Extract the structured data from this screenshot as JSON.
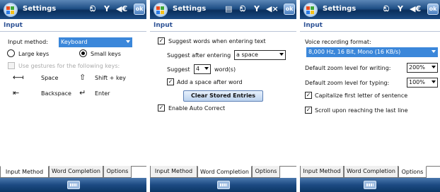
{
  "screens": [
    {
      "title": "Settings",
      "tray": {
        "signal": "ඞ",
        "antenna": "Υ",
        "volume": "◀€",
        "ok": "ok"
      },
      "section": "Input",
      "input_method_label": "Input method:",
      "input_method_value": "Keyboard",
      "large_keys_label": "Large keys",
      "small_keys_label": "Small keys",
      "selected_key_size": "small",
      "gestures_label": "Use gestures for the following keys:",
      "gestures": [
        {
          "icon": "space-gesture-icon",
          "glyph": "⟻",
          "label": "Space"
        },
        {
          "icon": "shift-gesture-icon",
          "glyph": "⇧",
          "label": "Shift + key"
        },
        {
          "icon": "backspace-gesture-icon",
          "glyph": "⇤",
          "label": "Backspace"
        },
        {
          "icon": "enter-gesture-icon",
          "glyph": "↵",
          "label": "Enter"
        }
      ],
      "tabs": [
        "Input Method",
        "Word Completion",
        "Options"
      ],
      "active_tab": 0
    },
    {
      "title": "Settings",
      "tray": {
        "extra": "▤",
        "signal": "ඞ",
        "antenna": "Υ",
        "volume": "◀×",
        "ok": "ok"
      },
      "section": "Input",
      "suggest_words_label": "Suggest words when entering text",
      "suggest_words_checked": true,
      "suggest_after_label": "Suggest after entering",
      "suggest_after_value": "a space",
      "suggest_count_label": "Suggest",
      "suggest_count_value": "4",
      "suggest_count_unit": "word(s)",
      "add_space_label": "Add a space after word",
      "add_space_checked": true,
      "clear_button_label": "Clear Stored Entries",
      "auto_correct_label": "Enable Auto Correct",
      "auto_correct_checked": true,
      "tabs": [
        "Input Method",
        "Word Completion",
        "Options"
      ],
      "active_tab": 1
    },
    {
      "title": "Settings",
      "tray": {
        "signal": "ඞ",
        "antenna": "Υ",
        "volume": "◀€",
        "ok": "ok"
      },
      "section": "Input",
      "voice_format_label": "Voice recording format:",
      "voice_format_value": "8,000 Hz, 16 Bit, Mono (16 KB/s)",
      "zoom_writing_label": "Default zoom level for writing:",
      "zoom_writing_value": "200%",
      "zoom_typing_label": "Default zoom level for typing:",
      "zoom_typing_value": "100%",
      "capitalize_label": "Capitalize first letter of sentence",
      "capitalize_checked": true,
      "scroll_label": "Scroll upon reaching the last line",
      "scroll_checked": true,
      "tabs": [
        "Input Method",
        "Word Completion",
        "Options"
      ],
      "active_tab": 2
    }
  ],
  "colors": {
    "titlebar": "#1f4f85",
    "section_text": "#2a4f93",
    "selection": "#3b87da"
  }
}
